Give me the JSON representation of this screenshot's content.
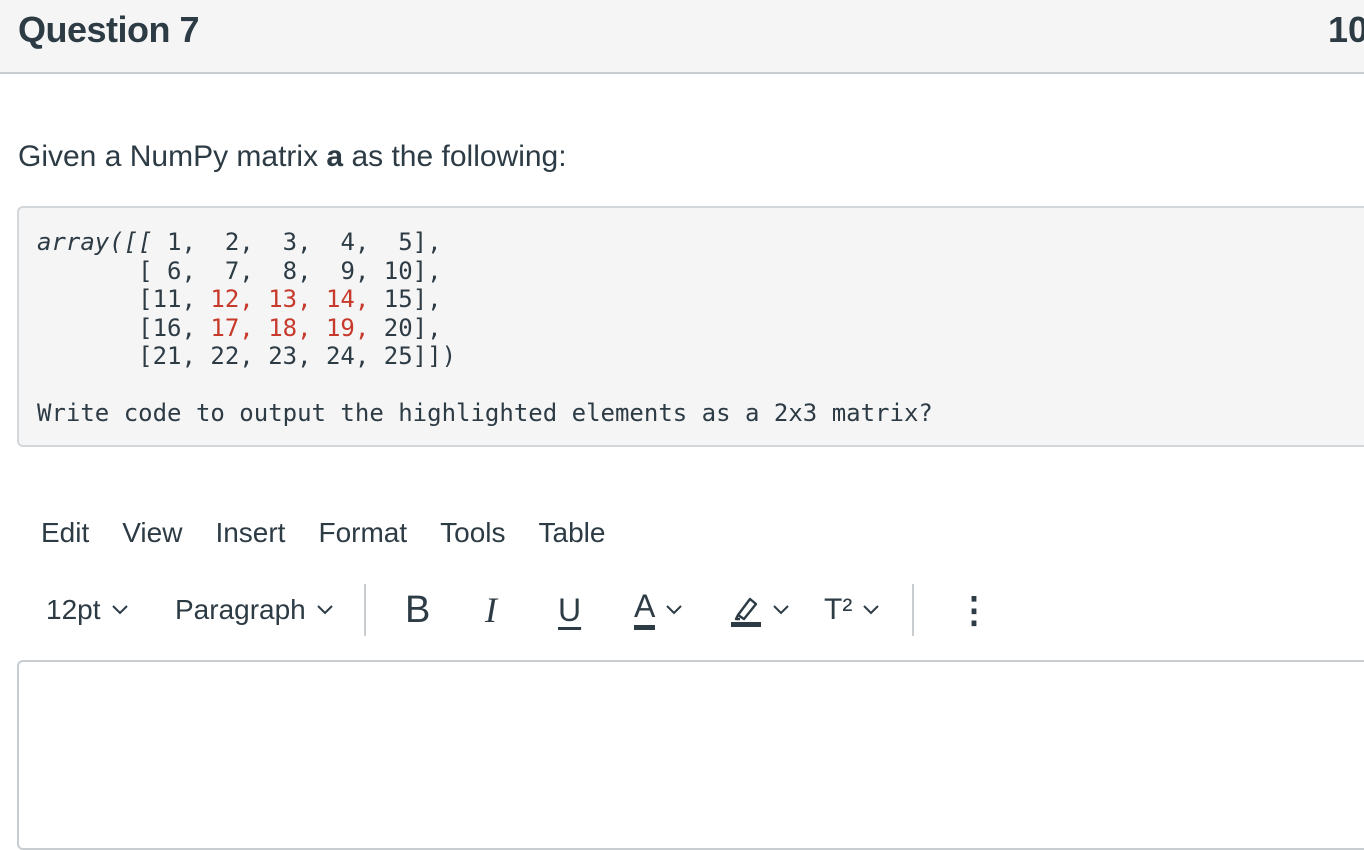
{
  "question": {
    "title": "Question 7",
    "points": "10"
  },
  "prompt": {
    "text_before": "Given a NumPy matrix ",
    "variable": "a",
    "text_after": " as the following:"
  },
  "code": {
    "lines": [
      {
        "prefix": "array([[ ",
        "plain": "1,  2,  3,  4,  5],"
      },
      {
        "prefix": "       [ ",
        "plain": "6,  7,  8,  9, 10],"
      },
      {
        "prefix": "       [",
        "plain": "11, ",
        "highlight": "12, 13, 14,",
        "rest": " 15],"
      },
      {
        "prefix": "       [",
        "plain": "16, ",
        "highlight": "17, 18, 19,",
        "rest": " 20],"
      },
      {
        "prefix": "       [",
        "plain": "21, 22, 23, 24, 25]])"
      }
    ],
    "question": "Write code to output the highlighted elements as a 2x3 matrix?",
    "highlight_color": "#c7392b"
  },
  "editor": {
    "menu": [
      "Edit",
      "View",
      "Insert",
      "Format",
      "Tools",
      "Table"
    ],
    "font_size": "12pt",
    "block_format": "Paragraph",
    "bold_label": "B",
    "italic_label": "I",
    "underline_label": "U",
    "text_color_label": "A",
    "superscript_label": "T²",
    "more_label": "⋮",
    "icons": [
      "chevron-down-icon",
      "highlighter-icon",
      "more-vertical-icon"
    ],
    "accent_color": "#2d3b45"
  }
}
